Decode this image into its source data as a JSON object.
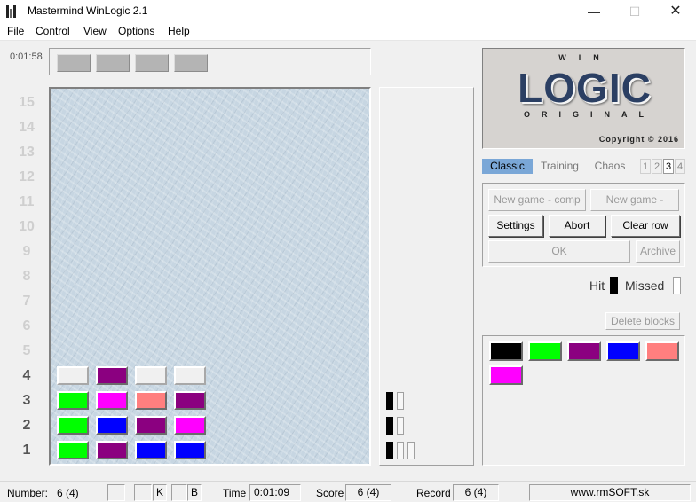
{
  "window": {
    "title": "Mastermind WinLogic 2.1",
    "min_glyph": "—",
    "max_glyph": "☐",
    "close_glyph": "✕"
  },
  "menu": [
    {
      "label": "File"
    },
    {
      "label": "Control"
    },
    {
      "label": "View"
    },
    {
      "label": "Options"
    },
    {
      "label": "Help"
    }
  ],
  "timer": "0:01:58",
  "row_numbers": [
    "15",
    "14",
    "13",
    "12",
    "11",
    "10",
    "9",
    "8",
    "7",
    "6",
    "5",
    "4",
    "3",
    "2",
    "1"
  ],
  "active_rows": [
    4,
    3,
    2,
    1
  ],
  "colors": {
    "black": "#000000",
    "green": "#00ff00",
    "purple": "#8b0080",
    "blue": "#0000ff",
    "salmon": "#ff7f7f",
    "magenta": "#ff00ff",
    "empty": "#f0f0f0",
    "hidden": "#b4b4b4"
  },
  "board_rows": [
    {
      "row": 1,
      "pegs": [
        "green",
        "purple",
        "blue",
        "blue"
      ],
      "hits": 1,
      "marks": 3
    },
    {
      "row": 2,
      "pegs": [
        "green",
        "blue",
        "purple",
        "magenta"
      ],
      "hits": 1,
      "marks": 2
    },
    {
      "row": 3,
      "pegs": [
        "green",
        "magenta",
        "salmon",
        "purple"
      ],
      "hits": 1,
      "marks": 2
    },
    {
      "row": 4,
      "pegs": [
        "empty",
        "purple",
        "empty",
        "empty"
      ],
      "hits": 0,
      "marks": 0
    }
  ],
  "logo": {
    "win": "WIN",
    "main": "LOGIC",
    "original": "ORIGINAL",
    "copyright": "Copyright © 2016"
  },
  "tabs": [
    {
      "label": "Classic",
      "active": true
    },
    {
      "label": "Training",
      "active": false
    },
    {
      "label": "Chaos",
      "active": false
    }
  ],
  "level_tabs": [
    {
      "label": "1",
      "active": false
    },
    {
      "label": "2",
      "active": false
    },
    {
      "label": "3",
      "active": true
    },
    {
      "label": "4",
      "active": false
    }
  ],
  "buttons": {
    "new_game_comp": "New game - comp",
    "new_game_player": "New game - player",
    "settings": "Settings",
    "abort": "Abort",
    "clear_row": "Clear row",
    "ok": "OK",
    "archive": "Archive",
    "delete_blocks": "Delete blocks"
  },
  "legend": {
    "hit": "Hit",
    "missed": "Missed"
  },
  "palette": [
    "black",
    "green",
    "purple",
    "blue",
    "salmon",
    "magenta"
  ],
  "status": {
    "number_label": "Number:",
    "number_value": "6 (4)",
    "k_label": "K",
    "b_label": "B",
    "time_label": "Time",
    "time_value": "0:01:09",
    "score_label": "Score",
    "score_value": "6 (4)",
    "record_label": "Record",
    "record_value": "6 (4)",
    "website": "www.rmSOFT.sk"
  }
}
